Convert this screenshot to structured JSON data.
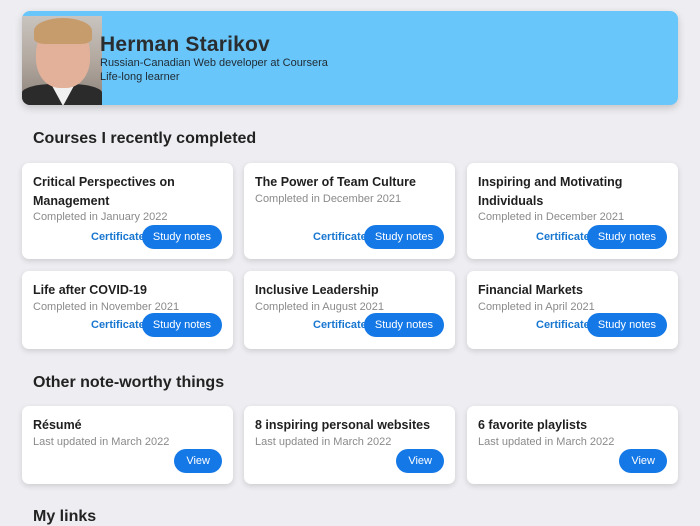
{
  "profile": {
    "name": "Herman Starikov",
    "subtitle": "Russian-Canadian Web developer at Coursera",
    "tagline": "Life-long learner"
  },
  "courses_section": {
    "title": "Courses I recently completed",
    "items": [
      {
        "title": "Critical Perspectives on Management",
        "meta": "Completed in January 2022",
        "cert_label": "Certificate",
        "notes_label": "Study notes"
      },
      {
        "title": "The Power of Team Culture",
        "meta": "Completed in December 2021",
        "cert_label": "Certificate",
        "notes_label": "Study notes"
      },
      {
        "title": "Inspiring and Motivating Individuals",
        "meta": "Completed in December 2021",
        "cert_label": "Certificate",
        "notes_label": "Study notes"
      },
      {
        "title": "Life after COVID-19",
        "meta": "Completed in November 2021",
        "cert_label": "Certificate",
        "notes_label": "Study notes"
      },
      {
        "title": "Inclusive Leadership",
        "meta": "Completed in August 2021",
        "cert_label": "Certificate",
        "notes_label": "Study notes"
      },
      {
        "title": "Financial Markets",
        "meta": "Completed in April 2021",
        "cert_label": "Certificate",
        "notes_label": "Study notes"
      }
    ]
  },
  "other_section": {
    "title": "Other note-worthy things",
    "items": [
      {
        "title": "Résumé",
        "meta": "Last updated in March 2022",
        "view_label": "View"
      },
      {
        "title": "8 inspiring personal websites",
        "meta": "Last updated in March 2022",
        "view_label": "View"
      },
      {
        "title": "6 favorite playlists",
        "meta": "Last updated in March 2022",
        "view_label": "View"
      }
    ]
  },
  "links_section": {
    "title": "My links"
  },
  "colors": {
    "header_bg": "#69c6fa",
    "accent": "#1478e6",
    "link": "#1776d0",
    "page_bg": "#eeeef2"
  }
}
